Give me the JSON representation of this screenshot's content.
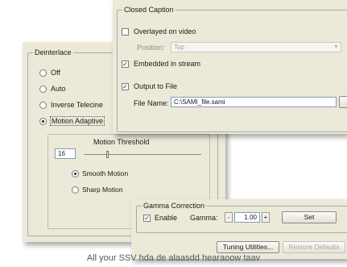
{
  "deinterlace": {
    "legend": "Deinterlace",
    "options": [
      {
        "label": "Off",
        "selected": false
      },
      {
        "label": "Auto",
        "selected": false
      },
      {
        "label": "Inverse Telecine",
        "selected": false
      },
      {
        "label": "Motion Adaptive",
        "selected": true
      }
    ],
    "motion_threshold": {
      "title": "Motion Threshold",
      "value": "16",
      "level": 0.2
    },
    "motion_modes": [
      {
        "label": "Smooth Motion",
        "selected": true
      },
      {
        "label": "Sharp Motion",
        "selected": false
      }
    ]
  },
  "closed_caption": {
    "legend": "Closed Caption",
    "overlayed": {
      "label": "Overlayed on video",
      "checked": false
    },
    "position_label": "Position:",
    "position_value": "Top",
    "embedded": {
      "label": "Embedded in stream",
      "checked": true
    },
    "output_to_file": {
      "label": "Output to File",
      "checked": true
    },
    "file_name_label": "File Name:",
    "file_name_value": "C:\\SAMI_file.sami"
  },
  "gamma": {
    "legend": "Gamma Correction",
    "enable": {
      "label": "Enable",
      "checked": true
    },
    "gamma_label": "Gamma:",
    "minus": "-",
    "value": "1.00",
    "plus": "+",
    "set_label": "Set"
  },
  "footer": {
    "tuning_label": "Tuning Utilities...",
    "restore_label": "Restore Defaults"
  },
  "caption_text": "All your SSV hda de alaasdd hearaoow taav"
}
